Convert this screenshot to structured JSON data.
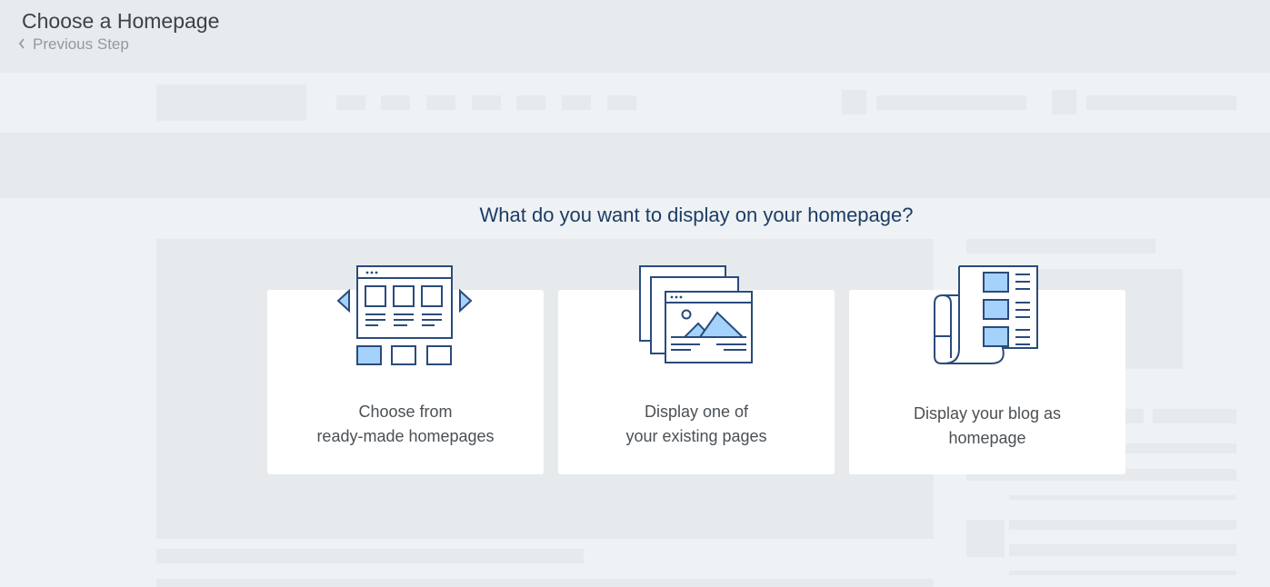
{
  "header": {
    "title": "Choose a Homepage",
    "previous_step": "Previous Step"
  },
  "main": {
    "question": "What do you want to display on your homepage?",
    "options": [
      {
        "label": "Choose from\nready-made homepages",
        "icon": "template-gallery-icon"
      },
      {
        "label": "Display one of\nyour existing pages",
        "icon": "existing-pages-icon"
      },
      {
        "label": "Display your blog as\nhomepage",
        "icon": "blog-newspaper-icon"
      }
    ]
  },
  "colors": {
    "accent_fill": "#a4d2fb",
    "icon_stroke": "#2a4b7c",
    "heading": "#1d3c66",
    "card_bg": "#ffffff",
    "background": "#eef2f4",
    "skeleton": "#e6eaec"
  }
}
